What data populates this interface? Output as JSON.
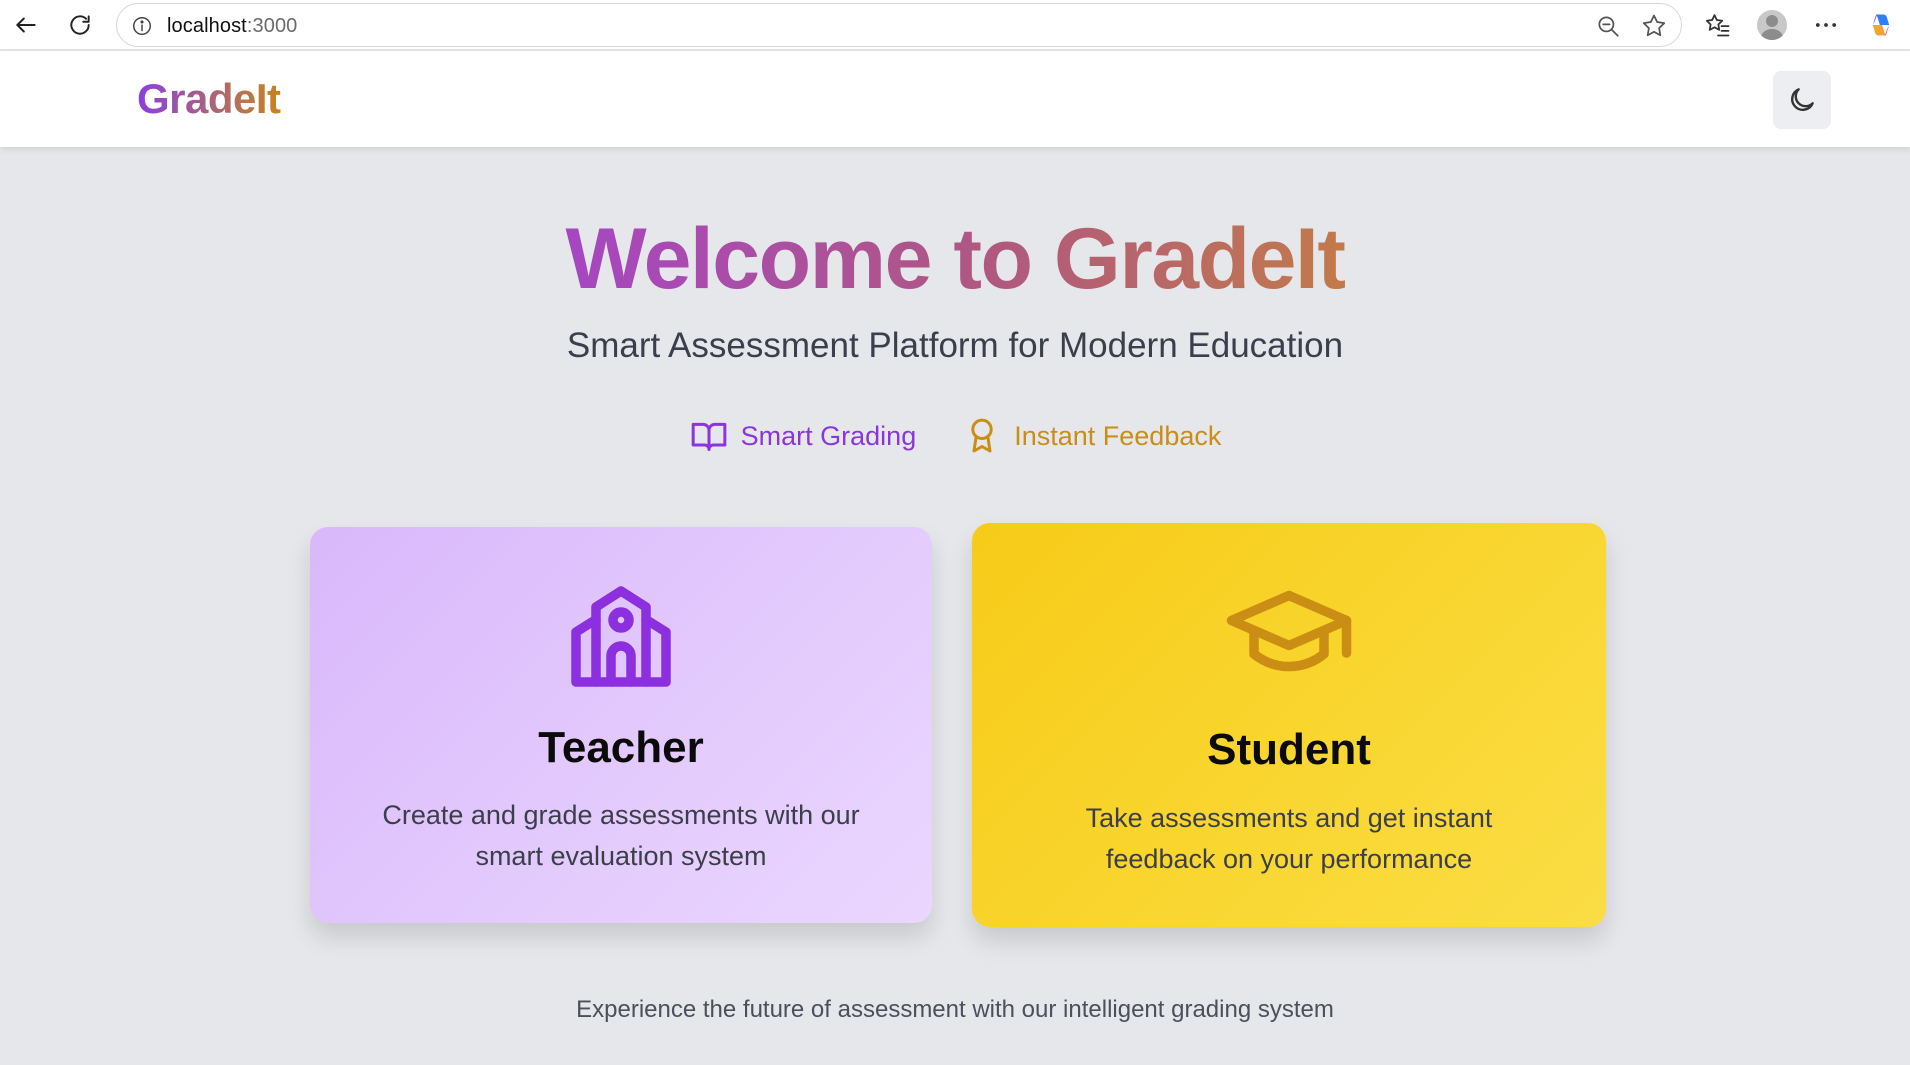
{
  "browser": {
    "url_host": "localhost",
    "url_port": ":3000"
  },
  "header": {
    "brand": "GradeIt"
  },
  "hero": {
    "title": "Welcome to GradeIt",
    "subtitle": "Smart Assessment Platform for Modern Education",
    "features": [
      {
        "label": "Smart Grading",
        "icon": "open-book-icon",
        "color": "#8a36dd"
      },
      {
        "label": "Instant Feedback",
        "icon": "award-ribbon-icon",
        "color": "#c98e13"
      }
    ]
  },
  "cards": [
    {
      "title": "Teacher",
      "description": "Create and grade assessments with our smart evaluation system",
      "icon": "school-building-icon",
      "color": "#d9b8fb"
    },
    {
      "title": "Student",
      "description": "Take assessments and get instant feedback on your performance",
      "icon": "graduation-cap-icon",
      "color": "#f7cb18"
    }
  ],
  "footer": {
    "note": "Experience the future of assessment with our intelligent grading system"
  }
}
